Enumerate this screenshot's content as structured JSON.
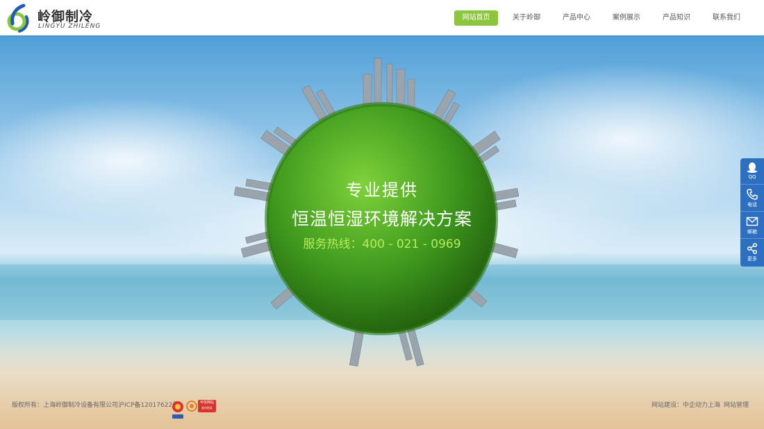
{
  "brand": {
    "name_cn": "岭御制冷",
    "name_en": "LINGYU ZHILENG",
    "logo_color_green": "#8cc63f",
    "logo_color_blue": "#1f5bb3"
  },
  "nav": {
    "items": [
      {
        "label": "网站首页",
        "active": true
      },
      {
        "label": "关于岭御",
        "active": false
      },
      {
        "label": "产品中心",
        "active": false
      },
      {
        "label": "案例展示",
        "active": false
      },
      {
        "label": "产品知识",
        "active": false
      },
      {
        "label": "联系我们",
        "active": false
      }
    ],
    "active_color": "#8cc63f"
  },
  "hero": {
    "line1": "专业提供",
    "line2": "恒温恒湿环境解决方案",
    "hotline": "服务热线：400 - 021 - 0969",
    "hotline_color": "#b8ec58"
  },
  "side_toolbar": {
    "color": "#2d6fc0",
    "items": [
      {
        "label": "QQ",
        "icon": "qq-penguin-icon"
      },
      {
        "label": "电话",
        "icon": "phone-icon"
      },
      {
        "label": "邮箱",
        "icon": "mail-icon"
      },
      {
        "label": "更多",
        "icon": "share-icon"
      }
    ]
  },
  "footer": {
    "copyright": "版权所有：上海岭御制冷设备有限公司",
    "icp": "沪ICP备12017622号",
    "badge_police": "police-emblem-badge",
    "badge_trust": "可信网站",
    "badge_trust_sub": "身份验证",
    "site_builder": "网站建设：中企动力上海",
    "admin": "网站管理"
  }
}
